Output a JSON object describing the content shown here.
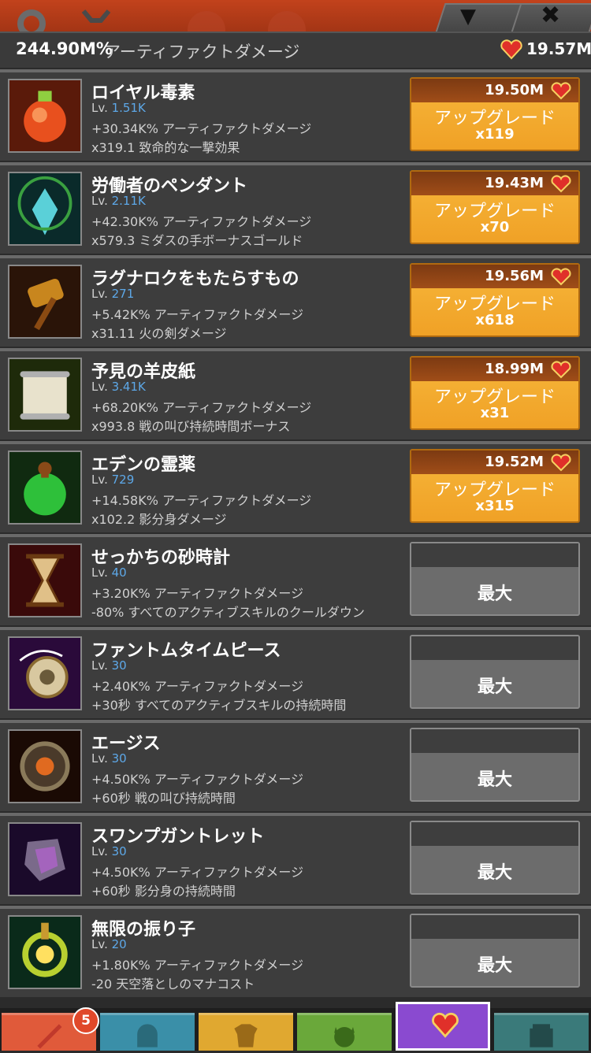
{
  "header": {
    "value": "244.90M%",
    "label": "アーティファクトダメージ",
    "currency": "19.57M"
  },
  "artifacts": [
    {
      "name": "ロイヤル毒素",
      "lv_prefix": "Lv. ",
      "lv": "1.51K",
      "d1": "+30.34K% アーティファクトダメージ",
      "d2": "x319.1 致命的な一撃効果",
      "state": "upgrade",
      "cost": "19.50M",
      "upgrade_label": "アップグレード",
      "mult": "x119"
    },
    {
      "name": "労働者のペンダント",
      "lv_prefix": "Lv. ",
      "lv": "2.11K",
      "d1": "+42.30K% アーティファクトダメージ",
      "d2": "x579.3 ミダスの手ボーナスゴールド",
      "state": "upgrade",
      "cost": "19.43M",
      "upgrade_label": "アップグレード",
      "mult": "x70"
    },
    {
      "name": "ラグナロクをもたらすもの",
      "lv_prefix": "Lv. ",
      "lv": "271",
      "d1": "+5.42K% アーティファクトダメージ",
      "d2": "x31.11 火の剣ダメージ",
      "state": "upgrade",
      "cost": "19.56M",
      "upgrade_label": "アップグレード",
      "mult": "x618"
    },
    {
      "name": "予見の羊皮紙",
      "lv_prefix": "Lv. ",
      "lv": "3.41K",
      "d1": "+68.20K% アーティファクトダメージ",
      "d2": "x993.8 戦の叫び持続時間ボーナス",
      "state": "upgrade",
      "cost": "18.99M",
      "upgrade_label": "アップグレード",
      "mult": "x31"
    },
    {
      "name": "エデンの霊薬",
      "lv_prefix": "Lv. ",
      "lv": "729",
      "d1": "+14.58K% アーティファクトダメージ",
      "d2": "x102.2 影分身ダメージ",
      "state": "upgrade",
      "cost": "19.52M",
      "upgrade_label": "アップグレード",
      "mult": "x315"
    },
    {
      "name": "せっかちの砂時計",
      "lv_prefix": "Lv. ",
      "lv": "40",
      "d1": "+3.20K% アーティファクトダメージ",
      "d2": "-80% すべてのアクティブスキルのクールダウン",
      "state": "max",
      "max_label": "最大"
    },
    {
      "name": "ファントムタイムピース",
      "lv_prefix": "Lv. ",
      "lv": "30",
      "d1": "+2.40K% アーティファクトダメージ",
      "d2": "+30秒 すべてのアクティブスキルの持続時間",
      "state": "max",
      "max_label": "最大"
    },
    {
      "name": "エージス",
      "lv_prefix": "Lv. ",
      "lv": "30",
      "d1": "+4.50K% アーティファクトダメージ",
      "d2": "+60秒 戦の叫び持続時間",
      "state": "max",
      "max_label": "最大"
    },
    {
      "name": "スワンプガントレット",
      "lv_prefix": "Lv. ",
      "lv": "30",
      "d1": "+4.50K% アーティファクトダメージ",
      "d2": "+60秒 影分身の持続時間",
      "state": "max",
      "max_label": "最大"
    },
    {
      "name": "無限の振り子",
      "lv_prefix": "Lv. ",
      "lv": "20",
      "d1": "+1.80K% アーティファクトダメージ",
      "d2": "-20 天空落としのマナコスト",
      "state": "max",
      "max_label": "最大"
    }
  ],
  "nav": {
    "badge_count": "5",
    "tabs": [
      {
        "icon": "sword-icon",
        "color": "#e05a3a"
      },
      {
        "icon": "helmet-icon",
        "color": "#3a8fa8"
      },
      {
        "icon": "armor-icon",
        "color": "#e0a830"
      },
      {
        "icon": "pet-icon",
        "color": "#6aa83a"
      },
      {
        "icon": "artifact-heart-icon",
        "color": "#8a4ad0"
      },
      {
        "icon": "shop-icon",
        "color": "#3a7a7a"
      }
    ]
  },
  "colors": {
    "level": "#5da8e8",
    "upgrade": "#f0a126",
    "max": "#6c6c6c"
  }
}
